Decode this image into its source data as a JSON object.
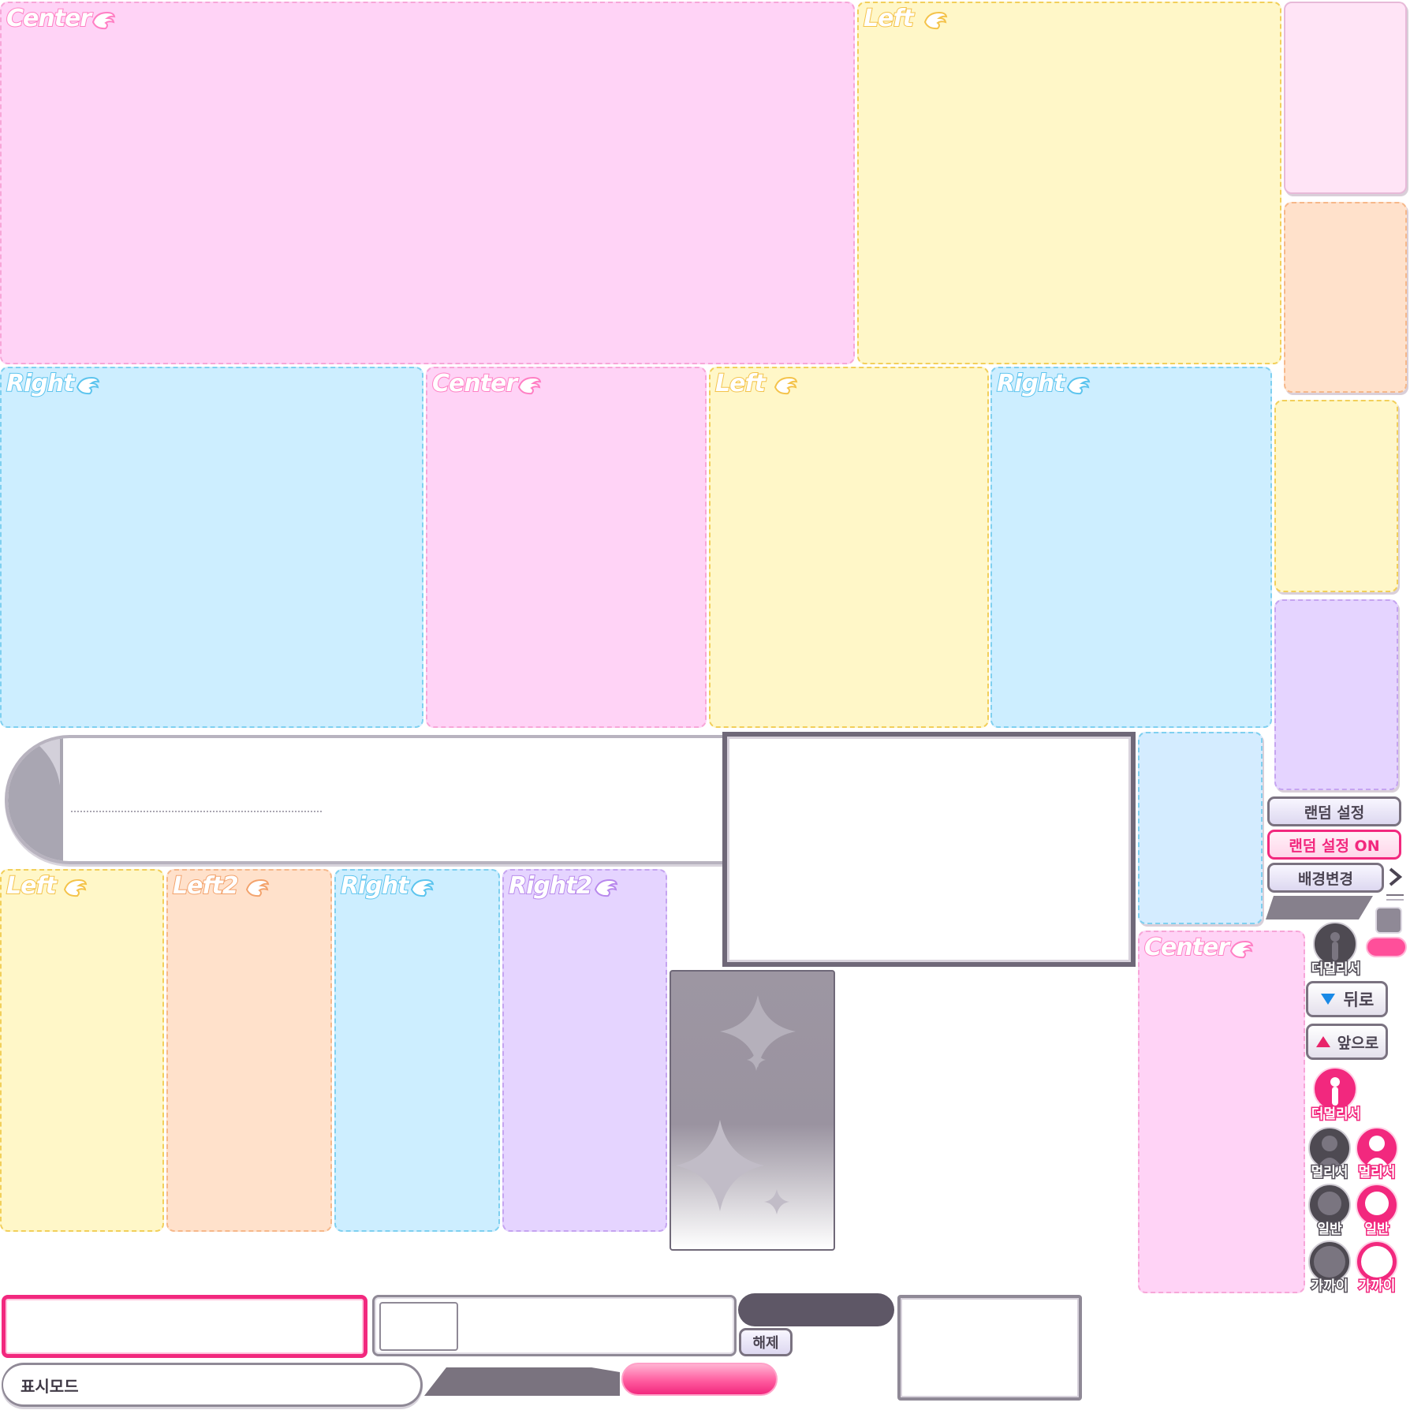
{
  "panels": {
    "top_center": "Center",
    "top_left": "Left",
    "mid_right": "Right",
    "mid_center": "Center",
    "mid_left": "Left",
    "mid_right2": "Right",
    "low_left": "Left",
    "low_left2": "Left2",
    "low_right": "Right",
    "low_right2": "Right2",
    "side_center": "Center"
  },
  "buttons": {
    "random": "랜덤 설정",
    "random_on": "랜덤 설정 ON",
    "background": "배경변경",
    "back": "뒤로",
    "forward": "앞으로",
    "release": "해제",
    "display_mode": "표시모드"
  },
  "distance": {
    "farthest_gray": "더멀리서",
    "farthest_pink": "더멀리서",
    "far_gray": "멀리서",
    "far_pink": "멀리서",
    "normal_gray": "일반",
    "normal_pink": "일반",
    "close_gray": "가까이",
    "close_pink": "가까이"
  },
  "colors": {
    "pink_panel": "#ffd3f6",
    "yellow_panel": "#fff7c8",
    "blue_panel": "#cdeeff",
    "peach_panel": "#ffe1cb",
    "lavender_panel": "#e5d4ff",
    "accent_pink": "#f2287e",
    "frame_gray": "#7a7280"
  }
}
